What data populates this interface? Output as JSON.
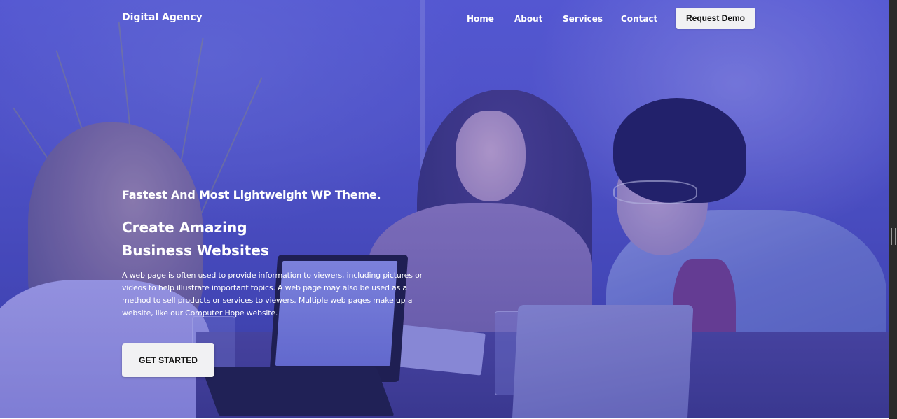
{
  "brand": {
    "name": "Digital Agency"
  },
  "nav": {
    "links": [
      {
        "label": "Home"
      },
      {
        "label": "About"
      },
      {
        "label": "Services"
      },
      {
        "label": "Contact"
      }
    ],
    "cta_label": "Request Demo"
  },
  "hero": {
    "tagline": "Fastest And Most Lightweight WP Theme.",
    "headline_line1": "Create Amazing",
    "headline_line2": "Business Websites",
    "description": "A web page is often used to provide information to viewers, including pictures or videos to help illustrate important topics. A web page may also be used as a method to sell products or services to viewers. Multiple web pages make up a website, like our Computer Hope website.",
    "button_label": "GET STARTED",
    "background": "photo of three people laughing at a table with laptops, blue overlay"
  },
  "colors": {
    "overlay": "#5458c6",
    "button_bg": "#f1f1f3",
    "button_text": "#111111",
    "text": "#ffffff"
  }
}
